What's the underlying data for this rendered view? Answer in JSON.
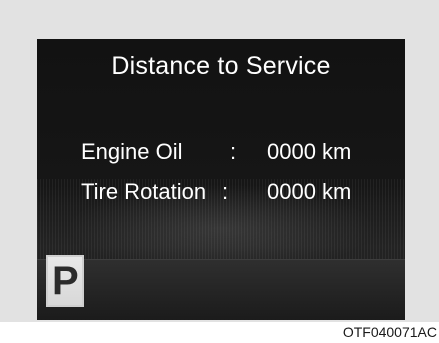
{
  "display": {
    "title": "Distance to Service",
    "rows": [
      {
        "label": "Engine Oil",
        "separator": ":",
        "value": "0000 km"
      },
      {
        "label": "Tire Rotation",
        "separator": ":",
        "value": "0000 km"
      }
    ],
    "gear_indicator": "P"
  },
  "caption": "OTF040071AC",
  "colors": {
    "frame": "#e2e2e2",
    "screen": "#141414",
    "text": "#ffffff"
  }
}
